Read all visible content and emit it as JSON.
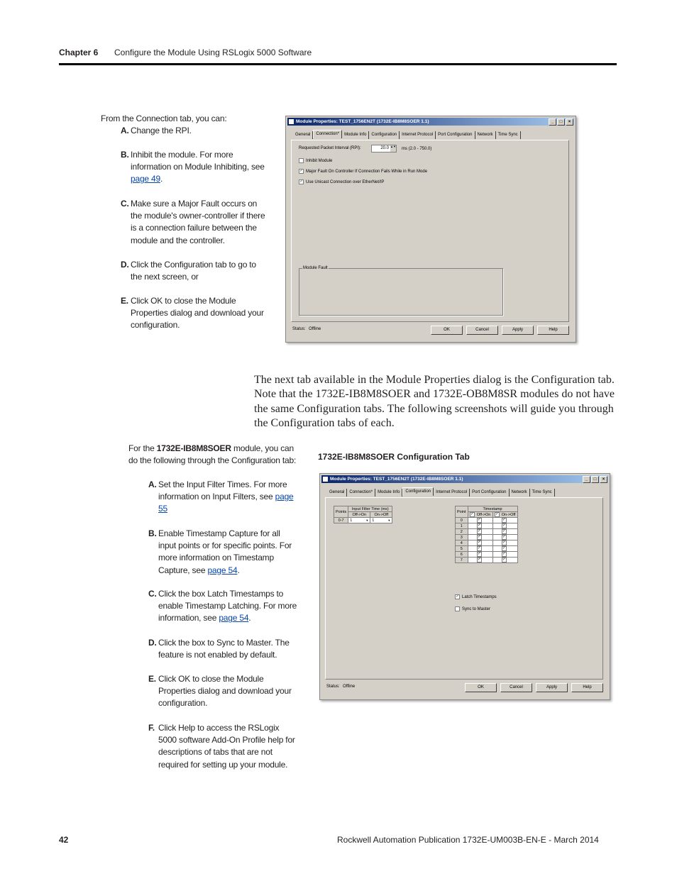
{
  "header": {
    "chapter": "Chapter 6",
    "title": "Configure the Module Using RSLogix 5000 Software"
  },
  "section1": {
    "intro": "From the Connection tab, you can:",
    "items": [
      {
        "letter": "A.",
        "text": "Change the RPI."
      },
      {
        "letter": "B.",
        "text": "Inhibit the module. For more information on Module Inhibiting, see ",
        "link": "page 49",
        "after": "."
      },
      {
        "letter": "C.",
        "text": "Make sure a Major Fault occurs on the module's owner-controller if there is a connection failure between the module and the controller."
      },
      {
        "letter": "D.",
        "text": "Click the Configuration tab to go to the next screen, or"
      },
      {
        "letter": "E.",
        "text": "Click OK to close the Module Properties dialog and download your configuration."
      }
    ]
  },
  "dialog1": {
    "title": "Module Properties: TEST_1756EN2T (1732E-IB8M8SOER 1.1)",
    "tabs": [
      "General",
      "Connection*",
      "Module Info",
      "Configuration",
      "Internet Protocol",
      "Port Configuration",
      "Network",
      "Time Sync"
    ],
    "active_tab": "Connection*",
    "rpi_label": "Requested Packet Interval (RPI):",
    "rpi_value": "20.0",
    "rpi_range": "ms (2.0 - 750.0)",
    "checks": [
      {
        "label": "Inhibit Module",
        "checked": false
      },
      {
        "label": "Major Fault On Controller If Connection Fails While in Run Mode",
        "checked": true
      },
      {
        "label": "Use Unicast Connection over EtherNet/IP",
        "checked": true
      }
    ],
    "group": "Module Fault",
    "status_label": "Status:",
    "status": "Offline",
    "buttons": [
      "OK",
      "Cancel",
      "Apply",
      "Help"
    ]
  },
  "paragraph": "The next tab available in the Module Properties dialog is the Configuration tab. Note that the 1732E-IB8M8SOER and 1732E-OB8M8SR modules do not have the same Configuration tabs. The following screenshots will guide you through the Configuration tabs of each.",
  "section2": {
    "intro_pre": "For the ",
    "intro_bold": "1732E-IB8M8SOER",
    "intro_post": " module, you can do the following through the Configuration tab:",
    "items": [
      {
        "letter": "A.",
        "text": "Set the Input Filter Times. For more information on Input Filters, see ",
        "link": "page 55",
        "after": ""
      },
      {
        "letter": "B.",
        "text": " Enable Timestamp Capture for all input points or for specific points. For more information on Timestamp Capture, see ",
        "link": "page 54",
        "after": "."
      },
      {
        "letter": "C.",
        "text": "Click the box Latch Timestamps to enable Timestamp Latching. For more information, see ",
        "link": "page 54",
        "after": "."
      },
      {
        "letter": "D.",
        "text": "Click the box to Sync to Master. The feature is not enabled by default."
      },
      {
        "letter": "E.",
        "text": "Click OK to close the Module Properties dialog and download your configuration."
      },
      {
        "letter": "F.",
        "text": "Click Help to access the RSLogix 5000 software Add-On Profile help for descriptions of tabs that are not required for setting up your module."
      }
    ]
  },
  "figure_caption": "1732E-IB8M8SOER Configuration Tab",
  "dialog2": {
    "title": "Module Properties: TEST_1756EN2T (1732E-IB8M8SOER 1.1)",
    "tabs": [
      "General",
      "Connection*",
      "Module Info",
      "Configuration",
      "Internet Protocol",
      "Port Configuration",
      "Network",
      "Time Sync"
    ],
    "active_tab": "Configuration",
    "filter": {
      "points_header": "Points",
      "group_header": "Input Filter Time (ms)",
      "col1": "Off->On",
      "col2": "On->Off",
      "row_label": "0-7",
      "val1": "1",
      "val2": "1"
    },
    "timestamp": {
      "point_header": "Point",
      "group_header": "Timestamp",
      "col1": "Off->On",
      "col2": "On->Off",
      "points": [
        "0",
        "1",
        "2",
        "3",
        "4",
        "5",
        "6",
        "7"
      ]
    },
    "checks": [
      {
        "label": "Latch Timestamps",
        "checked": true
      },
      {
        "label": "Sync to Master",
        "checked": false
      }
    ],
    "status_label": "Status:",
    "status": "Offline",
    "buttons": [
      "OK",
      "Cancel",
      "Apply",
      "Help"
    ]
  },
  "footer": {
    "page": "42",
    "publication": "Rockwell Automation Publication 1732E-UM003B-EN-E - March 2014"
  }
}
